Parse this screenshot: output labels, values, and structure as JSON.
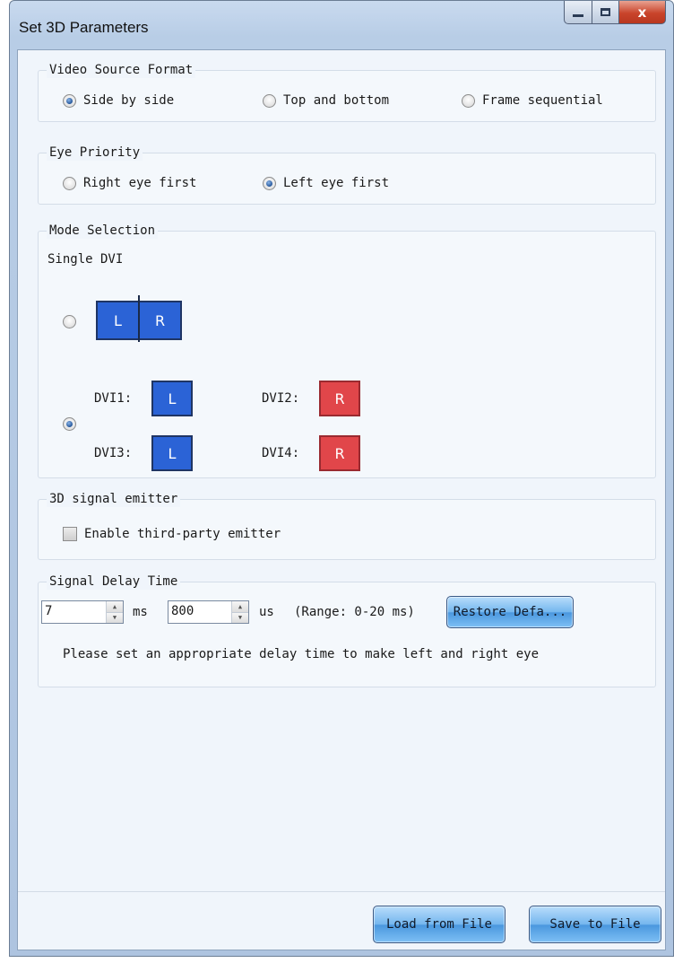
{
  "window": {
    "title": "Set 3D Parameters",
    "close_glyph": "x"
  },
  "video_source": {
    "legend": "Video Source Format",
    "options": [
      "Side by side",
      "Top and bottom",
      "Frame sequential"
    ],
    "selected": "Side by side"
  },
  "eye_priority": {
    "legend": "Eye Priority",
    "options": [
      "Right eye first",
      "Left eye first"
    ],
    "selected": "Left eye first"
  },
  "mode_selection": {
    "legend": "Mode Selection",
    "single_dvi_label": "Single DVI",
    "single_left": "L",
    "single_right": "R",
    "selected": "multi-dvi",
    "dvi": [
      {
        "label": "DVI1:",
        "eye": "L"
      },
      {
        "label": "DVI2:",
        "eye": "R"
      },
      {
        "label": "DVI3:",
        "eye": "L"
      },
      {
        "label": "DVI4:",
        "eye": "R"
      }
    ]
  },
  "emitter": {
    "legend": "3D signal emitter",
    "checkbox_label": "Enable third-party emitter",
    "checked": false
  },
  "signal_delay": {
    "legend": "Signal Delay Time",
    "ms_value": "7",
    "ms_unit": "ms",
    "us_value": "800",
    "us_unit": "us",
    "range_text": "(Range: 0-20 ms)",
    "restore_button": "Restore Defa...",
    "hint": "Please set an appropriate delay time to make left and right eye"
  },
  "footer": {
    "load_button": "Load from File",
    "save_button": "Save to File"
  },
  "colors": {
    "left_eye": "#2b63d6",
    "right_eye": "#e1464a",
    "button_blue": "#74b6ee"
  }
}
